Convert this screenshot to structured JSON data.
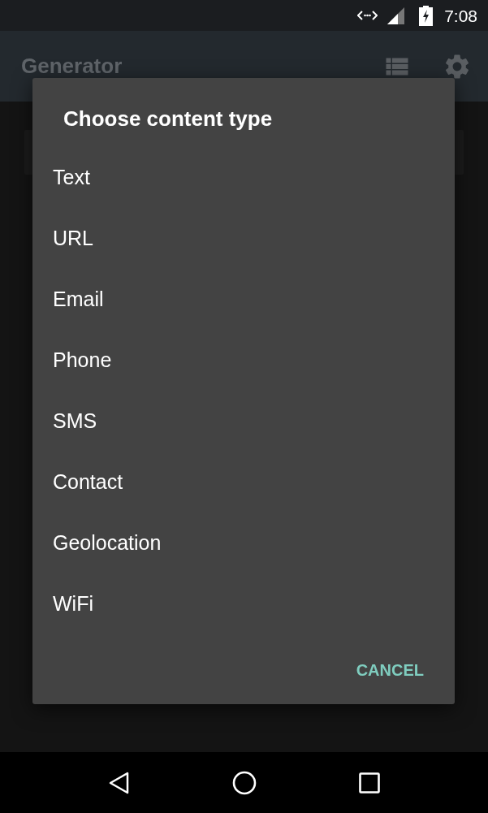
{
  "status_bar": {
    "time": "7:08"
  },
  "app_bar": {
    "title": "Generator"
  },
  "dialog": {
    "title": "Choose content type",
    "options": [
      {
        "label": "Text"
      },
      {
        "label": "URL"
      },
      {
        "label": "Email"
      },
      {
        "label": "Phone"
      },
      {
        "label": "SMS"
      },
      {
        "label": "Contact"
      },
      {
        "label": "Geolocation"
      },
      {
        "label": "WiFi"
      }
    ],
    "buttons": [
      {
        "label": "CANCEL"
      }
    ]
  }
}
